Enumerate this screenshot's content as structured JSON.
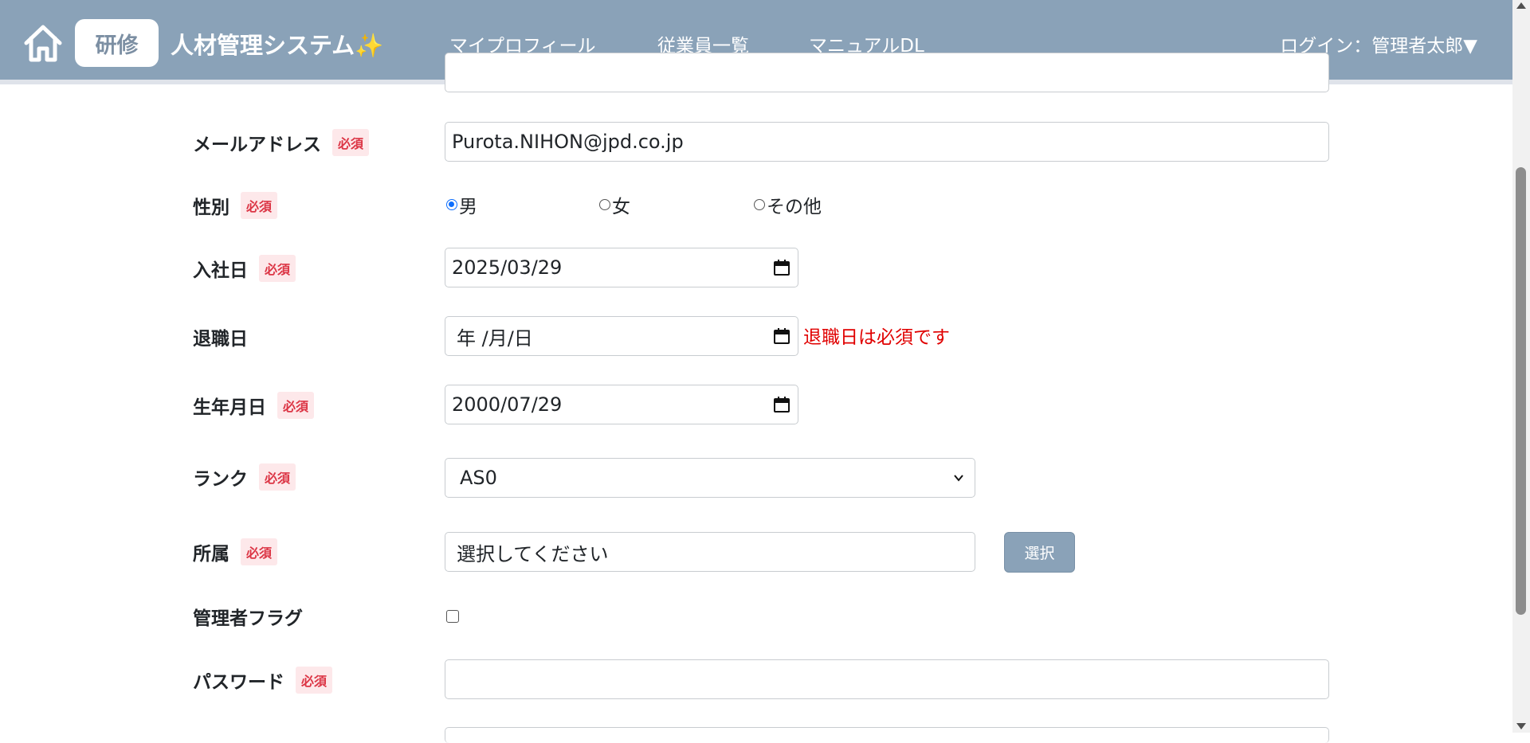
{
  "header": {
    "badge": "研修",
    "title": "人材管理システム✨",
    "nav": [
      "マイプロフィール",
      "従業員一覧",
      "マニュアルDL"
    ],
    "login": "ログイン：管理者太郎▼"
  },
  "form": {
    "required_label": "必須",
    "email": {
      "label": "メールアドレス",
      "value": "Purota.NIHON@jpd.co.jp"
    },
    "gender": {
      "label": "性別",
      "options": [
        "男",
        "女",
        "その他"
      ],
      "selected": "男"
    },
    "hire_date": {
      "label": "入社日",
      "value": "2025/03/29"
    },
    "retire_date": {
      "label": "退職日",
      "value": "年 /月/日",
      "error": "退職日は必須です"
    },
    "birth_date": {
      "label": "生年月日",
      "value": "2000/07/29"
    },
    "rank": {
      "label": "ランク",
      "value": "AS0"
    },
    "department": {
      "label": "所属",
      "value": "選択してください",
      "button": "選択"
    },
    "admin_flag": {
      "label": "管理者フラグ",
      "checked": false
    },
    "password": {
      "label": "パスワード",
      "value": ""
    }
  },
  "colors": {
    "header_bg": "#8aa2b8",
    "required_text": "#dc3545",
    "error_text": "#e00000",
    "radio_selected": "#0d6efd"
  }
}
